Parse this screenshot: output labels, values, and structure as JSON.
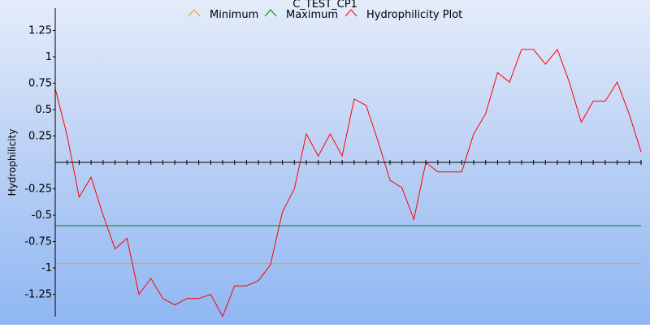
{
  "chart_data": {
    "type": "line",
    "title": "C_TEST_CP1",
    "xlabel": "",
    "ylabel": "Hydrophilicity",
    "ylim": [
      -1.45,
      1.45
    ],
    "legend_position": "top",
    "yticks": [
      {
        "value": 1.25,
        "label": "1.25"
      },
      {
        "value": 1.0,
        "label": "1"
      },
      {
        "value": 0.75,
        "label": "0.75"
      },
      {
        "value": 0.5,
        "label": "0.5"
      },
      {
        "value": 0.25,
        "label": "0.25"
      },
      {
        "value": -0.25,
        "label": "-0.25"
      },
      {
        "value": -0.5,
        "label": "-0.5"
      },
      {
        "value": -0.75,
        "label": "-0.75"
      },
      {
        "value": -1.0,
        "label": "-1"
      },
      {
        "value": -1.25,
        "label": "-1.25"
      }
    ],
    "series": [
      {
        "name": "Minimum",
        "color": "#ff9900",
        "values": [
          -0.96,
          -0.96
        ]
      },
      {
        "name": "Maximum",
        "color": "#008000",
        "values": [
          -0.6,
          -0.6
        ]
      },
      {
        "name": "Hydrophilicity Plot",
        "color": "#ff0000",
        "values": [
          0.7,
          0.25,
          -0.33,
          -0.14,
          -0.5,
          -0.82,
          -0.72,
          -1.25,
          -1.1,
          -1.29,
          -1.35,
          -1.29,
          -1.29,
          -1.25,
          -1.46,
          -1.17,
          -1.17,
          -1.12,
          -0.97,
          -0.47,
          -0.25,
          0.27,
          0.06,
          0.27,
          0.06,
          0.6,
          0.54,
          0.2,
          -0.17,
          -0.24,
          -0.54,
          0.0,
          -0.09,
          -0.09,
          -0.09,
          0.27,
          0.46,
          0.85,
          0.76,
          1.07,
          1.07,
          0.93,
          1.07,
          0.76,
          0.38,
          0.58,
          0.58,
          0.76,
          0.46,
          0.1
        ]
      }
    ]
  }
}
